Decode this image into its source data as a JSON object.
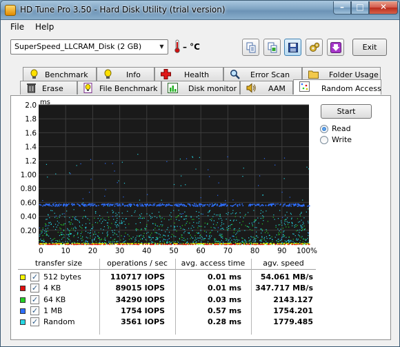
{
  "window": {
    "title": "HD Tune Pro 3.50 - Hard Disk Utility (trial version)",
    "controls": {
      "minimize": "–",
      "maximize": "□",
      "close": "✕"
    }
  },
  "menu": {
    "file": "File",
    "help": "Help"
  },
  "toolbar": {
    "drive": "SuperSpeed_LLCRAM_Disk (2 GB)",
    "temperature": "– °C",
    "exit_label": "Exit",
    "icons": [
      "copy-text-icon",
      "copy-image-icon",
      "save-icon",
      "options-icon",
      "download-icon"
    ]
  },
  "tabs": {
    "row1": [
      "Benchmark",
      "Info",
      "Health",
      "Error Scan",
      "Folder Usage"
    ],
    "row2": [
      "Erase",
      "File Benchmark",
      "Disk monitor",
      "AAM",
      "Random Access"
    ],
    "active": "Random Access"
  },
  "controls": {
    "start_label": "Start",
    "read_label": "Read",
    "write_label": "Write",
    "mode": "Read"
  },
  "chart_data": {
    "type": "scatter",
    "ylabel": "ms",
    "ylim": [
      0,
      2.0
    ],
    "xlim": [
      0,
      100
    ],
    "y_ticks": [
      "2.0",
      "1.8",
      "1.6",
      "1.4",
      "1.2",
      "1.00",
      "0.80",
      "0.60",
      "0.40",
      "0.20"
    ],
    "x_ticks": [
      "0",
      "10",
      "20",
      "30",
      "40",
      "50",
      "60",
      "70",
      "80",
      "90",
      "100%"
    ],
    "background": "#1a1a1a",
    "grid": true,
    "series": [
      {
        "name": "512 bytes",
        "color": "#f7f700",
        "avg_ms": 0.01
      },
      {
        "name": "4 KB",
        "color": "#e01010",
        "avg_ms": 0.01
      },
      {
        "name": "64 KB",
        "color": "#25d025",
        "avg_ms": 0.03
      },
      {
        "name": "1 MB",
        "color": "#2f6fff",
        "avg_ms": 0.57
      },
      {
        "name": "Random",
        "color": "#26d7e4",
        "avg_ms": 0.28
      }
    ]
  },
  "table": {
    "headers": [
      "transfer size",
      "operations / sec",
      "avg. access time",
      "agv. speed"
    ],
    "rows": [
      {
        "size": "512 bytes",
        "ops": "110717 IOPS",
        "access": "0.01 ms",
        "speed": "54.061 MB/s",
        "color": "#f7f700"
      },
      {
        "size": "4 KB",
        "ops": "89015 IOPS",
        "access": "0.01 ms",
        "speed": "347.717 MB/s",
        "color": "#e01010"
      },
      {
        "size": "64 KB",
        "ops": "34290 IOPS",
        "access": "0.03 ms",
        "speed": "2143.127",
        "color": "#25d025"
      },
      {
        "size": "1 MB",
        "ops": "1754 IOPS",
        "access": "0.57 ms",
        "speed": "1754.201",
        "color": "#2f6fff"
      },
      {
        "size": "Random",
        "ops": "3561 IOPS",
        "access": "0.28 ms",
        "speed": "1779.485",
        "color": "#26d7e4"
      }
    ]
  }
}
